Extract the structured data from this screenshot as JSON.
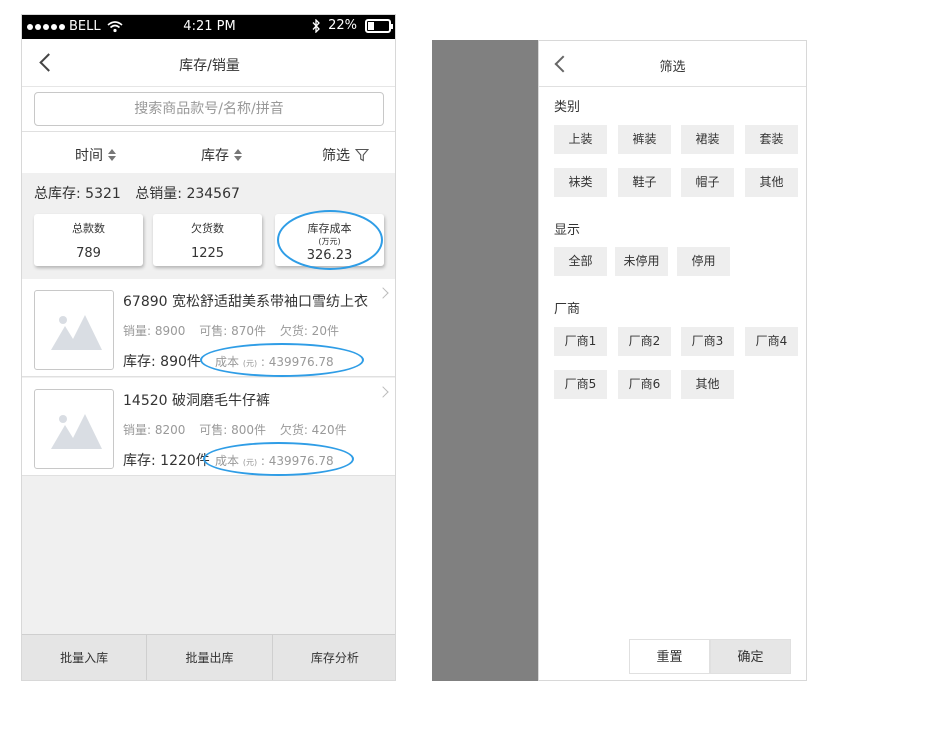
{
  "status_bar": {
    "carrier": "BELL",
    "time": "4:21 PM",
    "battery": "22%"
  },
  "nav": {
    "title": "库存/销量"
  },
  "search": {
    "placeholder": "搜索商品款号/名称/拼音"
  },
  "sort_bar": {
    "time_label": "时间",
    "stock_label": "库存",
    "filter_label": "筛选"
  },
  "summary": {
    "total_stock_label": "总库存:",
    "total_stock": "5321",
    "total_sales_label": "总销量:",
    "total_sales": "234567",
    "cards": [
      {
        "label": "总款数",
        "unit": "",
        "value": "789"
      },
      {
        "label": "欠货数",
        "unit": "",
        "value": "1225"
      },
      {
        "label": "库存成本",
        "unit": "(万元)",
        "value": "326.23"
      }
    ]
  },
  "products": [
    {
      "title": "67890 宽松舒适甜美系带袖口雪纺上衣",
      "sales": "销量: 8900",
      "available": "可售: 870件",
      "owed": "欠货: 20件",
      "stock": "库存: 890件",
      "cost_label": "成本",
      "cost_unit": "(元)",
      "cost_value": ": 439976.78"
    },
    {
      "title": "14520 破洞磨毛牛仔裤",
      "sales": "销量: 8200",
      "available": "可售: 800件",
      "owed": "欠货: 420件",
      "stock": "库存: 1220件",
      "cost_label": "成本",
      "cost_unit": "(元)",
      "cost_value": ": 439976.78"
    }
  ],
  "tab_bar": [
    "批量入库",
    "批量出库",
    "库存分析"
  ],
  "filter": {
    "title": "筛选",
    "category_label": "类别",
    "categories": [
      "上装",
      "裤装",
      "裙装",
      "套装",
      "袜类",
      "鞋子",
      "帽子",
      "其他"
    ],
    "display_label": "显示",
    "display_options": [
      "全部",
      "未停用",
      "停用"
    ],
    "vendor_label": "厂商",
    "vendors": [
      "厂商1",
      "厂商2",
      "厂商3",
      "厂商4",
      "厂商5",
      "厂商6",
      "其他"
    ],
    "reset_label": "重置",
    "confirm_label": "确定"
  },
  "colors": {
    "annotation": "#2f9de6",
    "overlay": "#808080",
    "chip_bg": "#eeeeee"
  },
  "icons": [
    "back-chevron-icon",
    "wifi-icon",
    "bluetooth-icon",
    "battery-icon",
    "sort-arrows-icon",
    "filter-funnel-icon",
    "image-placeholder-icon",
    "chevron-right-icon"
  ]
}
